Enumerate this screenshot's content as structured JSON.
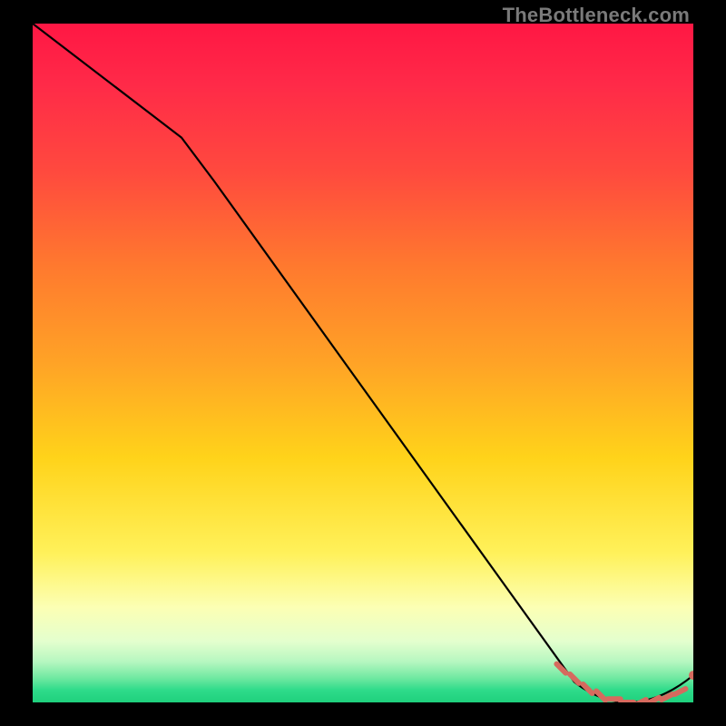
{
  "watermark": "TheBottleneck.com",
  "chart_data": {
    "type": "line",
    "title": "",
    "xlabel": "",
    "ylabel": "",
    "xlim": [
      0,
      100
    ],
    "ylim": [
      0,
      100
    ],
    "series": [
      {
        "name": "black-curve",
        "x": [
          0,
          25,
          82,
          90,
          100
        ],
        "values": [
          100,
          80,
          3,
          0,
          4
        ]
      },
      {
        "name": "dashed-segment",
        "x": [
          80,
          82,
          84,
          86,
          88,
          90,
          92,
          94,
          96,
          98
        ],
        "values": [
          5,
          3.5,
          2,
          1,
          0.5,
          0,
          0,
          0.3,
          0.8,
          1.6
        ]
      }
    ],
    "annotations": [],
    "colors": {
      "curve": "#000000",
      "dashed": "#d66a5e",
      "gradient_top": "#ff1744",
      "gradient_mid": "#ffd31a",
      "gradient_bottom": "#1fd07d"
    }
  }
}
